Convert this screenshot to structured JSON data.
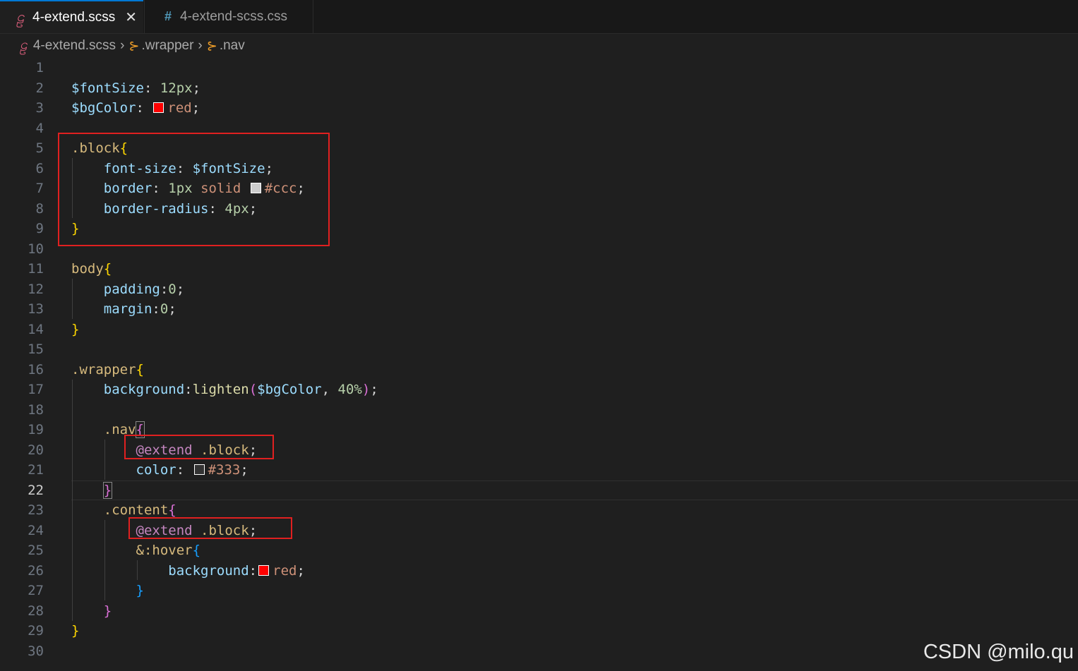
{
  "tabs": [
    {
      "label": "4-extend.scss",
      "icon": "sass-icon",
      "active": true,
      "close": "✕"
    },
    {
      "label": "4-extend-scss.css",
      "icon": "css-hash-icon",
      "active": false
    }
  ],
  "breadcrumb": {
    "file": "4-extend.scss",
    "items": [
      ".wrapper",
      ".nav"
    ]
  },
  "editor": {
    "active_line": 22,
    "line_numbers": [
      "1",
      "2",
      "3",
      "4",
      "5",
      "6",
      "7",
      "8",
      "9",
      "10",
      "11",
      "12",
      "13",
      "14",
      "15",
      "16",
      "17",
      "18",
      "19",
      "20",
      "21",
      "22",
      "23",
      "24",
      "25",
      "26",
      "27",
      "28",
      "29",
      "30"
    ],
    "colors": {
      "red": "#ff0000",
      "ccc": "#cccccc",
      "333": "#333333"
    }
  },
  "watermark": "CSDN @milo.qu"
}
